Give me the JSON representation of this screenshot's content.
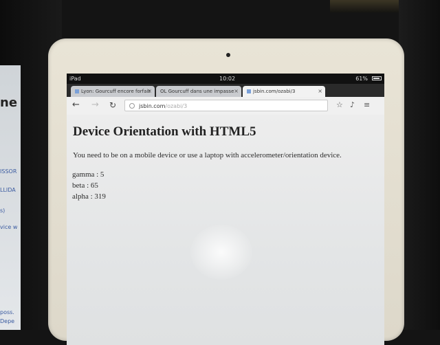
{
  "device": {
    "carrier": "iPad",
    "time": "10:02",
    "battery": "61%"
  },
  "tabs": [
    {
      "label": "Lyon: Gourcuff encore forfait",
      "active": false
    },
    {
      "label": "OL Gourcuff dans une impasse",
      "active": false
    },
    {
      "label": "jsbin.com/ozabi/3",
      "active": true
    }
  ],
  "toolbar": {
    "url_host": "jsbin.com",
    "url_path": "/ozabi/3"
  },
  "page": {
    "heading": "Device Orientation with HTML5",
    "intro": "You need to be on a mobile device or use a laptop with accelerometer/orientation device.",
    "gamma": "gamma : 5",
    "beta": "beta : 65",
    "alpha": "alpha : 319"
  },
  "laptop_fragments": {
    "big": "ne .",
    "lines": [
      "ISSOR",
      "LLIDA",
      "s)",
      "vice w",
      "poss.",
      "Depe"
    ]
  },
  "icons": {
    "back": "back-arrow-icon",
    "forward": "forward-arrow-icon",
    "reload": "reload-icon",
    "star": "star-icon",
    "mic": "microphone-icon",
    "menu": "menu-icon"
  }
}
